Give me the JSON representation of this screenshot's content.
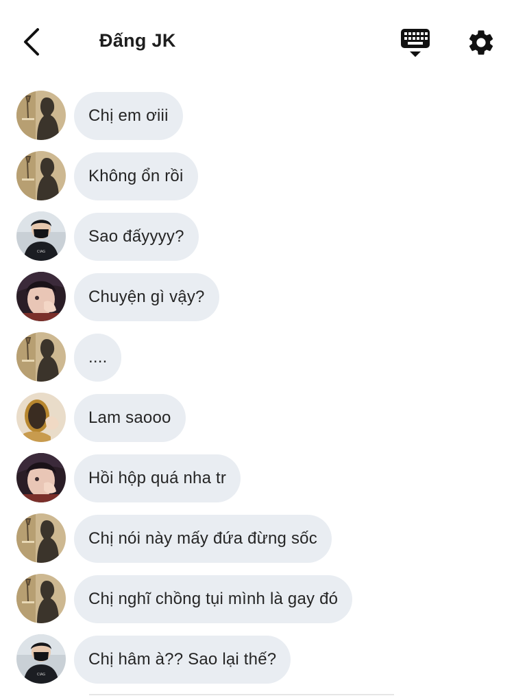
{
  "header": {
    "title": "Đấng JK",
    "back_icon": "chevron-left-icon",
    "keyboard_icon": "keyboard-icon",
    "settings_icon": "gear-icon"
  },
  "colors": {
    "bubble_bg": "#e9edf2",
    "text": "#252525",
    "icon": "#111111"
  },
  "messages": [
    {
      "sender_avatar": "shadow-figure",
      "text": "Chị em ơiii"
    },
    {
      "sender_avatar": "shadow-figure",
      "text": "Không ổn rồi"
    },
    {
      "sender_avatar": "masked-person",
      "text": "Sao đấyyyy?"
    },
    {
      "sender_avatar": "hand-face",
      "text": "Chuyện gì vậy?"
    },
    {
      "sender_avatar": "shadow-figure",
      "text": "...."
    },
    {
      "sender_avatar": "golden-mirror",
      "text": "Lam saooo"
    },
    {
      "sender_avatar": "hand-face",
      "text": "Hồi hộp quá nha tr"
    },
    {
      "sender_avatar": "shadow-figure",
      "text": "Chị nói này mấy đứa đừng sốc"
    },
    {
      "sender_avatar": "shadow-figure",
      "text": "Chị nghĩ chồng tụi mình là gay đó"
    },
    {
      "sender_avatar": "masked-person",
      "text": "Chị hâm à?? Sao lại thế?"
    }
  ]
}
